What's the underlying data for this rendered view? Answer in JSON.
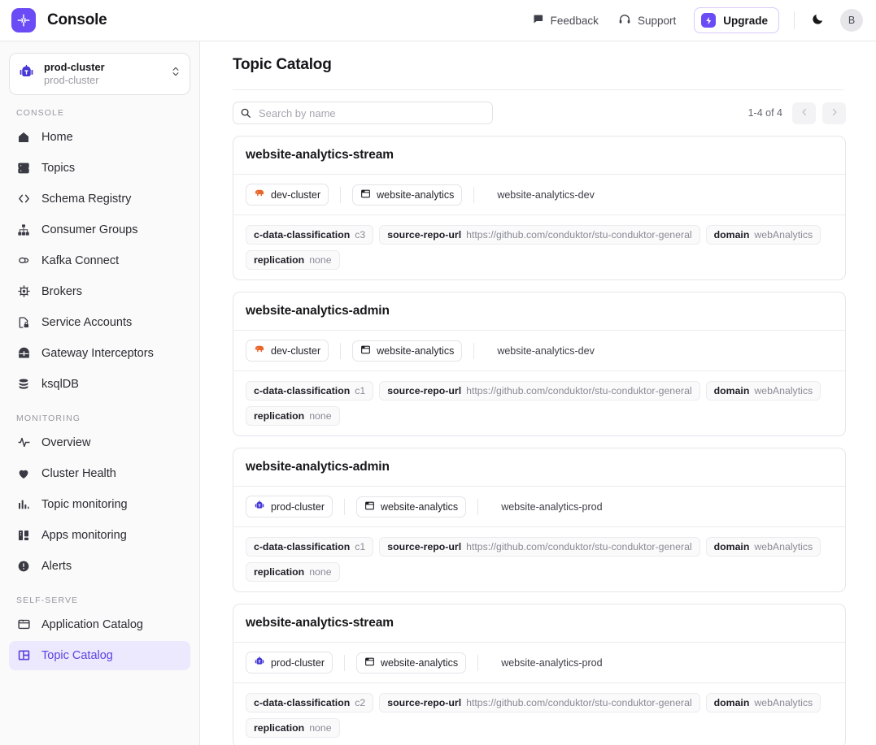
{
  "header": {
    "brand": "Console",
    "logo_icon": "conduktor-logo-icon",
    "feedback_label": "Feedback",
    "feedback_icon": "chat-bubble-icon",
    "support_label": "Support",
    "support_icon": "headset-icon",
    "upgrade_label": "Upgrade",
    "upgrade_icon": "lightning-bolt-icon",
    "theme_icon": "moon-icon",
    "avatar_initial": "B"
  },
  "sidebar": {
    "cluster_selector": {
      "icon": "kafka-robot-icon",
      "name": "prod-cluster",
      "subtitle": "prod-cluster",
      "chevron_icon": "chevron-up-down-icon"
    },
    "groups": [
      {
        "label": "CONSOLE",
        "items": [
          {
            "label": "Home",
            "icon": "home-icon",
            "active": false
          },
          {
            "label": "Topics",
            "icon": "topics-icon",
            "active": false
          },
          {
            "label": "Schema Registry",
            "icon": "code-brackets-icon",
            "active": false
          },
          {
            "label": "Consumer Groups",
            "icon": "hierarchy-icon",
            "active": false
          },
          {
            "label": "Kafka Connect",
            "icon": "connect-link-icon",
            "active": false
          },
          {
            "label": "Brokers",
            "icon": "chip-icon",
            "active": false
          },
          {
            "label": "Service Accounts",
            "icon": "file-lock-icon",
            "active": false
          },
          {
            "label": "Gateway Interceptors",
            "icon": "gateway-shield-icon",
            "active": false
          },
          {
            "label": "ksqlDB",
            "icon": "database-icon",
            "active": false
          }
        ]
      },
      {
        "label": "MONITORING",
        "items": [
          {
            "label": "Overview",
            "icon": "activity-pulse-icon",
            "active": false
          },
          {
            "label": "Cluster Health",
            "icon": "heart-icon",
            "active": false
          },
          {
            "label": "Topic monitoring",
            "icon": "bar-chart-icon",
            "active": false
          },
          {
            "label": "Apps monitoring",
            "icon": "apps-grid-icon",
            "active": false
          },
          {
            "label": "Alerts",
            "icon": "alert-circle-icon",
            "active": false
          }
        ]
      },
      {
        "label": "SELF-SERVE",
        "items": [
          {
            "label": "Application Catalog",
            "icon": "folder-icon",
            "active": false
          },
          {
            "label": "Topic Catalog",
            "icon": "layout-grid-icon",
            "active": true
          }
        ]
      }
    ]
  },
  "page": {
    "title": "Topic Catalog"
  },
  "search": {
    "placeholder": "Search by name",
    "value": "",
    "icon": "search-icon"
  },
  "pagination": {
    "range_label": "1-4 of 4",
    "prev_icon": "chevron-left-icon",
    "next_icon": "chevron-right-icon"
  },
  "cards": [
    {
      "title": "website-analytics-stream",
      "cluster": {
        "label": "dev-cluster",
        "icon": "elephant-icon",
        "color": "#e8662a"
      },
      "application": {
        "label": "website-analytics",
        "icon": "window-icon"
      },
      "context": "website-analytics-dev",
      "meta": [
        {
          "key": "c-data-classification",
          "value": "c3"
        },
        {
          "key": "source-repo-url",
          "value": "https://github.com/conduktor/stu-conduktor-general"
        },
        {
          "key": "domain",
          "value": "webAnalytics"
        },
        {
          "key": "replication",
          "value": "none"
        }
      ]
    },
    {
      "title": "website-analytics-admin",
      "cluster": {
        "label": "dev-cluster",
        "icon": "elephant-icon",
        "color": "#e8662a"
      },
      "application": {
        "label": "website-analytics",
        "icon": "window-icon"
      },
      "context": "website-analytics-dev",
      "meta": [
        {
          "key": "c-data-classification",
          "value": "c1"
        },
        {
          "key": "source-repo-url",
          "value": "https://github.com/conduktor/stu-conduktor-general"
        },
        {
          "key": "domain",
          "value": "webAnalytics"
        },
        {
          "key": "replication",
          "value": "none"
        }
      ]
    },
    {
      "title": "website-analytics-admin",
      "cluster": {
        "label": "prod-cluster",
        "icon": "kafka-robot-icon",
        "color": "#4538d6"
      },
      "application": {
        "label": "website-analytics",
        "icon": "window-icon"
      },
      "context": "website-analytics-prod",
      "meta": [
        {
          "key": "c-data-classification",
          "value": "c1"
        },
        {
          "key": "source-repo-url",
          "value": "https://github.com/conduktor/stu-conduktor-general"
        },
        {
          "key": "domain",
          "value": "webAnalytics"
        },
        {
          "key": "replication",
          "value": "none"
        }
      ]
    },
    {
      "title": "website-analytics-stream",
      "cluster": {
        "label": "prod-cluster",
        "icon": "kafka-robot-icon",
        "color": "#4538d6"
      },
      "application": {
        "label": "website-analytics",
        "icon": "window-icon"
      },
      "context": "website-analytics-prod",
      "meta": [
        {
          "key": "c-data-classification",
          "value": "c2"
        },
        {
          "key": "source-repo-url",
          "value": "https://github.com/conduktor/stu-conduktor-general"
        },
        {
          "key": "domain",
          "value": "webAnalytics"
        },
        {
          "key": "replication",
          "value": "none"
        }
      ]
    }
  ],
  "colors": {
    "accent": "#6a4bf5",
    "active_nav_bg": "#ece9fe",
    "active_nav_fg": "#5b43e0",
    "dev_cluster": "#e8662a",
    "prod_cluster": "#4538d6"
  }
}
